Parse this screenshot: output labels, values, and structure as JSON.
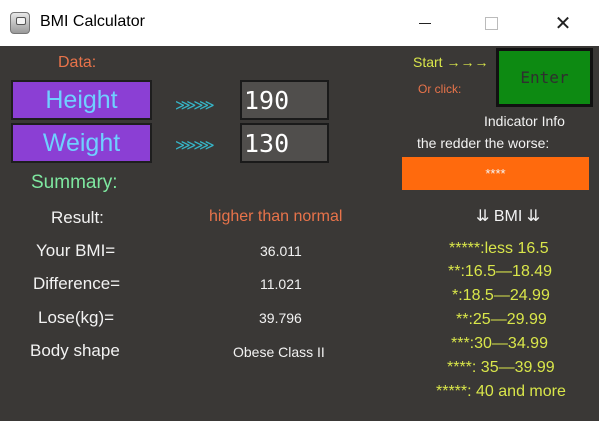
{
  "window": {
    "title": "BMI Calculator",
    "close_glyph": "✕"
  },
  "form": {
    "data_label": "Data:",
    "height_label": "Height",
    "weight_label": "Weight",
    "arrow_glyph": "⋙⋙",
    "height_value": "190",
    "weight_value": "130"
  },
  "summary": {
    "title": "Summary:",
    "rows": [
      {
        "label": "Result:",
        "value": "higher than normal"
      },
      {
        "label": "Your BMI=",
        "value": "36.011"
      },
      {
        "label": "Difference=",
        "value": "11.021"
      },
      {
        "label": "Lose(kg)=",
        "value": "39.796"
      },
      {
        "label": "Body shape",
        "value": "Obese Class II"
      }
    ]
  },
  "controls": {
    "start_label": "Start →→→",
    "or_click_label": "Or click:",
    "enter_label": "Enter"
  },
  "indicator": {
    "info_line1": "Indicator Info",
    "info_line2": "the redder the worse:",
    "value": "****",
    "color": "#ff6a0d"
  },
  "legend": {
    "title": "⇊ BMI ⇊",
    "items": [
      "*****:less 16.5",
      "**:16.5—18.49",
      "*:18.5—24.99",
      "**:25—29.99",
      "***:30—34.99",
      "****: 35—39.99",
      "*****: 40 and more"
    ]
  },
  "colors": {
    "background": "#3a3836",
    "field_button": "#8b3fd4",
    "enter_button": "#0d8a12",
    "accent_orange": "#e8734a",
    "accent_yellow": "#d9e64a",
    "accent_green": "#7ee8a0"
  }
}
